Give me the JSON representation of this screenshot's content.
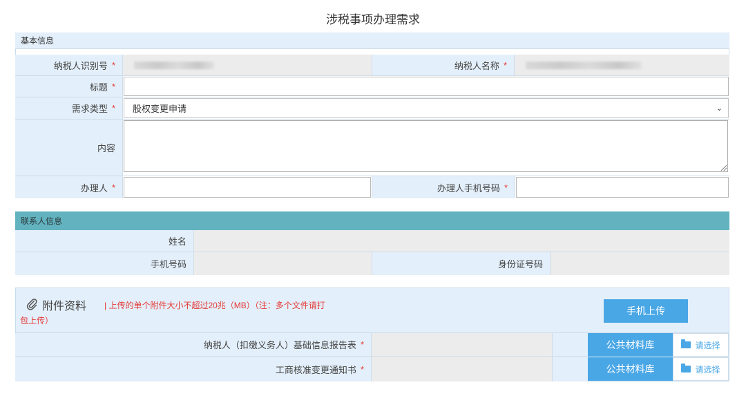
{
  "page_title": "涉税事项办理需求",
  "basic": {
    "header": "基本信息",
    "taxpayer_id_label": "纳税人识别号",
    "taxpayer_name_label": "纳税人名称",
    "title_label": "标题",
    "demand_type_label": "需求类型",
    "demand_type_value": "股权变更申请",
    "content_label": "内容",
    "handler_label": "办理人",
    "handler_phone_label": "办理人手机号码",
    "required_mark": "*"
  },
  "contact": {
    "header": "联系人信息",
    "name_label": "姓名",
    "phone_label": "手机号码",
    "id_label": "身份证号码"
  },
  "attachments": {
    "title": "附件资料",
    "note_line1": "| 上传的单个附件大小不超过20兆（MB）（注：多个文件请打",
    "note_line2": "包上传）",
    "mobile_upload_label": "手机上传",
    "items": [
      {
        "label": "纳税人（扣缴义务人）基础信息报告表",
        "lib_label": "公共材料库",
        "select_label": "请选择"
      },
      {
        "label": "工商核准变更通知书",
        "lib_label": "公共材料库",
        "select_label": "请选择"
      }
    ]
  },
  "colors": {
    "label_bg": "#e3effa",
    "teal_header": "#62b3bf",
    "accent_blue": "#4aa7e6",
    "required_red": "#e53935"
  }
}
